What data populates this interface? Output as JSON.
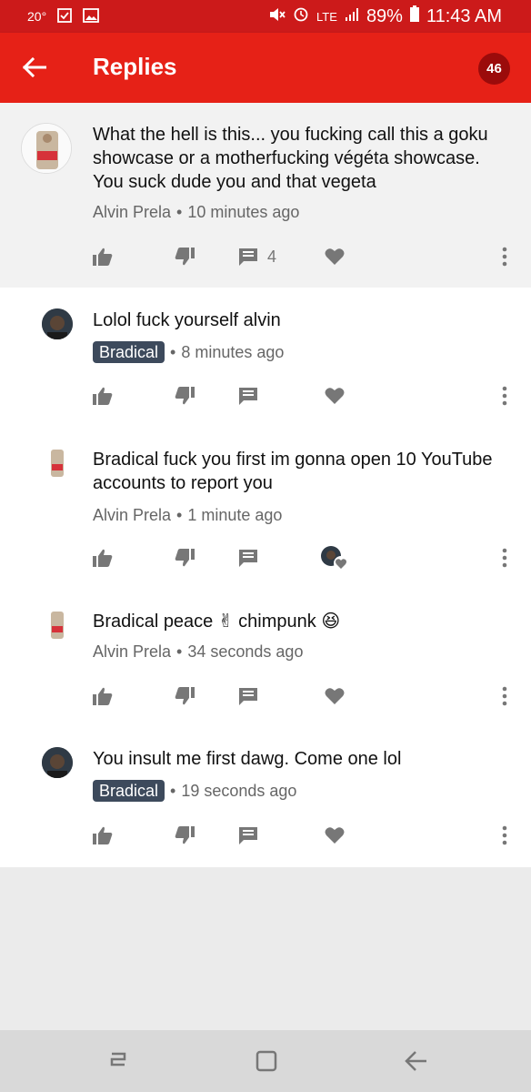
{
  "status_bar": {
    "temperature": "20°",
    "battery_percent": "89%",
    "time": "11:43 AM",
    "network": "LTE"
  },
  "header": {
    "title": "Replies",
    "count": "46"
  },
  "parent_comment": {
    "text": "What the hell is this... you fucking call this a goku showcase or a motherfucking végéta showcase. You suck dude you and that vegeta",
    "author": "Alvin Prela",
    "time": "10 minutes ago",
    "reply_count": "4"
  },
  "replies": [
    {
      "text": "Lolol fuck yourself alvin",
      "author": "Bradical",
      "author_is_creator": true,
      "time": "8 minutes ago"
    },
    {
      "text": "Bradical fuck you first im gonna open 10 YouTube accounts to report you",
      "author": "Alvin Prela",
      "author_is_creator": false,
      "time": "1 minute ago",
      "hearted": true
    },
    {
      "text": "Bradical peace ✌ chimpunk 😆",
      "author": "Alvin Prela",
      "author_is_creator": false,
      "time": "34 seconds ago"
    },
    {
      "text": "You insult me first dawg. Come one lol",
      "author": "Bradical",
      "author_is_creator": true,
      "time": "19 seconds ago"
    }
  ],
  "meta_separator": "•",
  "colors": {
    "app_bar": "#e62117",
    "status_bar": "#cc1a1a",
    "creator_chip": "#3d4a5c",
    "icon_gray": "#777777"
  }
}
